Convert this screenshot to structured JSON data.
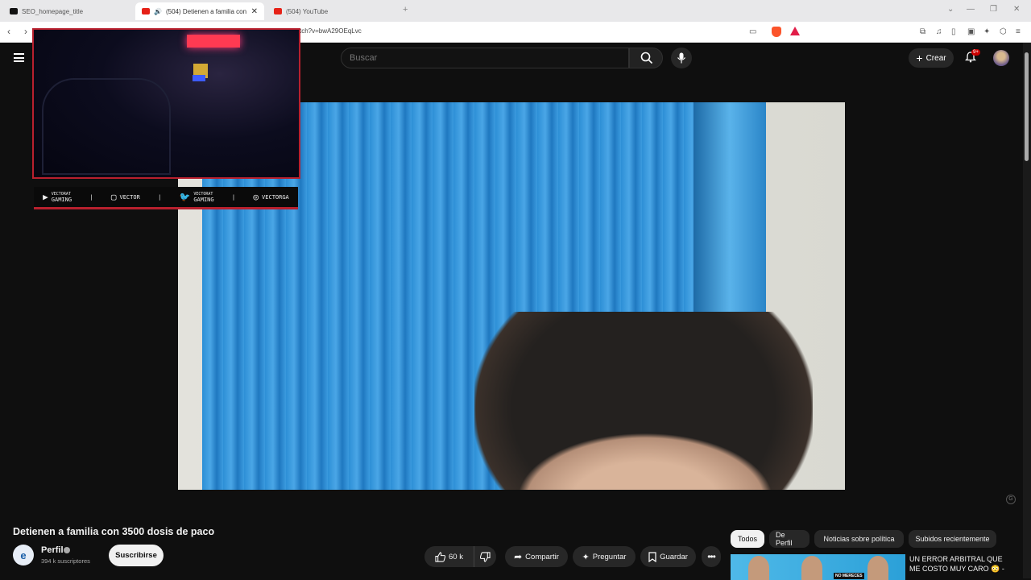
{
  "browser": {
    "tabs": [
      {
        "label": "SEO_homepage_title",
        "icon": "tiktok-icon",
        "active": false
      },
      {
        "label": "(504) Detienen a familia con",
        "icon": "youtube-icon",
        "active": true
      },
      {
        "label": "(504) YouTube",
        "icon": "youtube-icon",
        "active": false
      }
    ],
    "url": "tch?v=bwA29OEqLvc",
    "new_tab": "+"
  },
  "yt": {
    "search_placeholder": "Buscar",
    "create_label": "Crear",
    "notif_badge": "9+"
  },
  "overlay": {
    "sign_text": "",
    "socials": [
      {
        "icon": "youtube-icon",
        "label_top": "VECTORAT",
        "label": "GAMING"
      },
      {
        "icon": "twitch-icon",
        "label_top": "",
        "label": "VECTOR"
      },
      {
        "icon": "twitter-icon",
        "label_top": "VECTORAT",
        "label": "GAMING"
      },
      {
        "icon": "instagram-icon",
        "label_top": "",
        "label": "VECTORGA"
      }
    ]
  },
  "video": {
    "title": "Detienen a familia con 3500 dosis de paco",
    "channel": {
      "name": "Perfil",
      "subs": "394 k suscriptores",
      "initial": "e"
    },
    "subscribe_label": "Suscribirse",
    "likes": "60 k",
    "share_label": "Compartir",
    "ask_label": "Preguntar",
    "save_label": "Guardar"
  },
  "chips": [
    "Todos",
    "De Perfil",
    "Noticias sobre política",
    "Subidos recientemente"
  ],
  "recommended": {
    "title": "UN ERROR ARBITRAL QUE ME COSTO MUY CARO 😳 -",
    "thumb_label": "NO MERECES"
  },
  "colors": {
    "accent_red": "#b8202e",
    "yt_bg": "#0f0f0f",
    "notif_red": "#cc0000"
  }
}
